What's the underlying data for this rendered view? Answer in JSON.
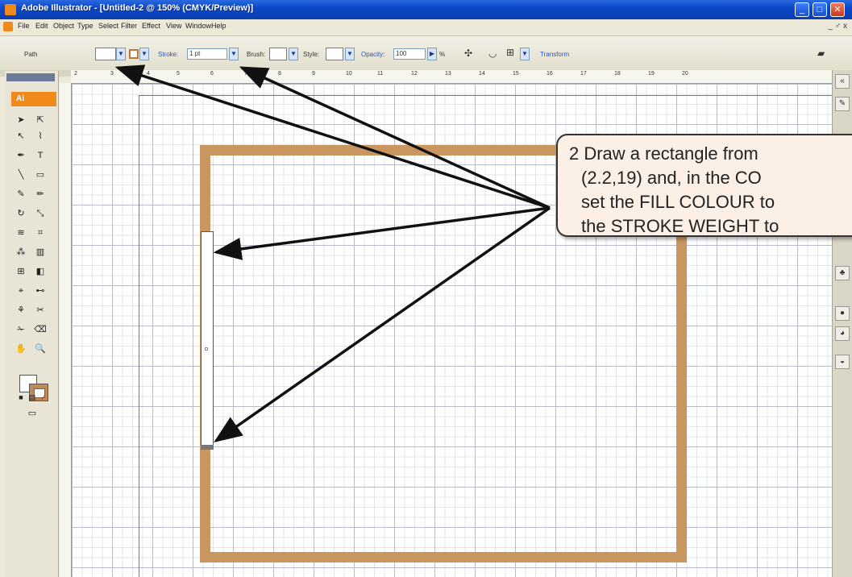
{
  "window": {
    "title": "Adobe Illustrator - [Untitled-2 @ 150% (CMYK/Preview)]",
    "controls": [
      "minimize-icon",
      "maximize-icon",
      "close-icon"
    ]
  },
  "menu": {
    "items": [
      "File",
      "Edit",
      "Object",
      "Type",
      "Select",
      "Filter",
      "Effect",
      "View",
      "Window",
      "Help"
    ],
    "right_controls": "_ ♂ x"
  },
  "control_bar": {
    "selection_label": "Path",
    "stroke_label": "Stroke:",
    "stroke_weight_value": "1 pt",
    "brush_label": "Brush:",
    "style_label": "Style:",
    "opacity_label": "Opacity:",
    "opacity_value": "100",
    "opacity_unit": "%",
    "transform_label": "Transform"
  },
  "ruler": {
    "numbers": [
      "2",
      "3",
      "4",
      "5",
      "6",
      "7",
      "8",
      "9",
      "10",
      "11",
      "12",
      "13",
      "14",
      "15",
      "16",
      "17",
      "18",
      "19",
      "20"
    ]
  },
  "toolbox": {
    "logo": "Ai"
  },
  "colors": {
    "titlebar": "#0b48c8",
    "rect_stroke": "#c9965f",
    "callout_bg": "#fbefe6",
    "ai_orange": "#f08a1a"
  },
  "callout": {
    "lines": [
      "2  Draw a rectangle from",
      "(2.2,19) and, in the CO",
      "set the FILL COLOUR to",
      "the STROKE WEIGHT to"
    ]
  }
}
